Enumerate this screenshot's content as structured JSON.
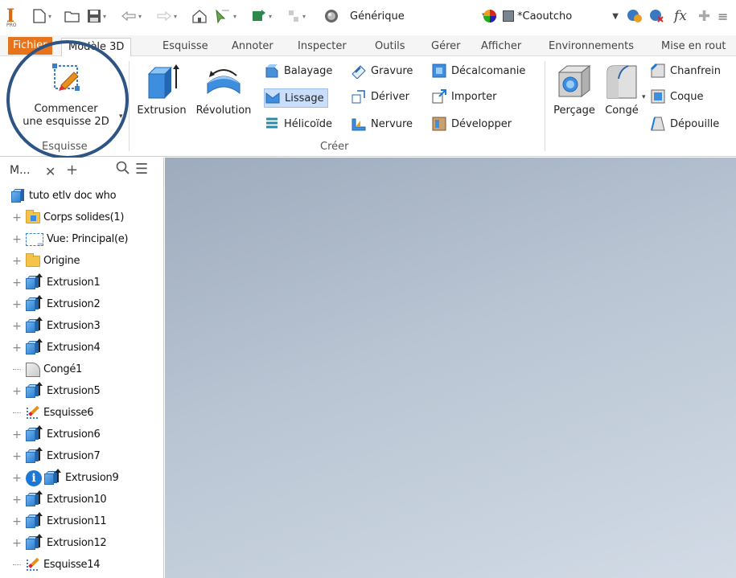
{
  "quick_access": {
    "material_combo": "Générique",
    "appearance_combo": "*Caoutcho",
    "fx_label": "fx"
  },
  "tabs": [
    {
      "label": "Fichier"
    },
    {
      "label": "Modèle 3D"
    },
    {
      "label": "Esquisse"
    },
    {
      "label": "Annoter"
    },
    {
      "label": "Inspecter"
    },
    {
      "label": "Outils"
    },
    {
      "label": "Gérer"
    },
    {
      "label": "Afficher"
    },
    {
      "label": "Environnements"
    },
    {
      "label": "Mise en rout"
    }
  ],
  "ribbon": {
    "esquisse_panel": {
      "start_sketch_label_1": "Commencer",
      "start_sketch_label_2": "une esquisse 2D",
      "title": "Esquisse"
    },
    "creer_panel": {
      "title": "Créer",
      "extrusion": "Extrusion",
      "revolution": "Révolution",
      "balayage": "Balayage",
      "lissage": "Lissage",
      "helicoide": "Hélicoïde",
      "gravure": "Gravure",
      "deriver": "Dériver",
      "nervure": "Nervure",
      "decalcomanie": "Décalcomanie",
      "importer": "Importer",
      "developper": "Développer"
    },
    "modifier_panel": {
      "percage": "Perçage",
      "conge": "Congé",
      "chanfrein": "Chanfrein",
      "coque": "Coque",
      "depouille": "Dépouille"
    }
  },
  "browser": {
    "tab_label": "M...",
    "root": "tuto etlv doc who",
    "items": [
      {
        "label": "Corps solides(1)",
        "icon": "solid-bodies-folder-icon",
        "expandable": true
      },
      {
        "label": "Vue: Principal(e)",
        "icon": "view-icon",
        "expandable": true
      },
      {
        "label": "Origine",
        "icon": "folder-icon",
        "expandable": true
      },
      {
        "label": "Extrusion1",
        "icon": "extrusion-icon",
        "expandable": true
      },
      {
        "label": "Extrusion2",
        "icon": "extrusion-icon",
        "expandable": true
      },
      {
        "label": "Extrusion3",
        "icon": "extrusion-icon",
        "expandable": true
      },
      {
        "label": "Extrusion4",
        "icon": "extrusion-icon",
        "expandable": true
      },
      {
        "label": "Congé1",
        "icon": "fillet-icon",
        "expandable": false
      },
      {
        "label": "Extrusion5",
        "icon": "extrusion-icon",
        "expandable": true
      },
      {
        "label": "Esquisse6",
        "icon": "sketch-icon",
        "expandable": false
      },
      {
        "label": "Extrusion6",
        "icon": "extrusion-icon",
        "expandable": true
      },
      {
        "label": "Extrusion7",
        "icon": "extrusion-icon",
        "expandable": true
      },
      {
        "label": "Extrusion9",
        "icon": "extrusion-icon",
        "expandable": true,
        "info": true
      },
      {
        "label": "Extrusion10",
        "icon": "extrusion-icon",
        "expandable": true
      },
      {
        "label": "Extrusion11",
        "icon": "extrusion-icon",
        "expandable": true
      },
      {
        "label": "Extrusion12",
        "icon": "extrusion-icon",
        "expandable": true
      },
      {
        "label": "Esquisse14",
        "icon": "sketch-icon",
        "expandable": false
      }
    ]
  },
  "colors": {
    "accent": "#e8731d",
    "highlight_ring": "#2e5484",
    "canvas_top": "#9eabbd",
    "canvas_bottom": "#d2dbe6"
  }
}
